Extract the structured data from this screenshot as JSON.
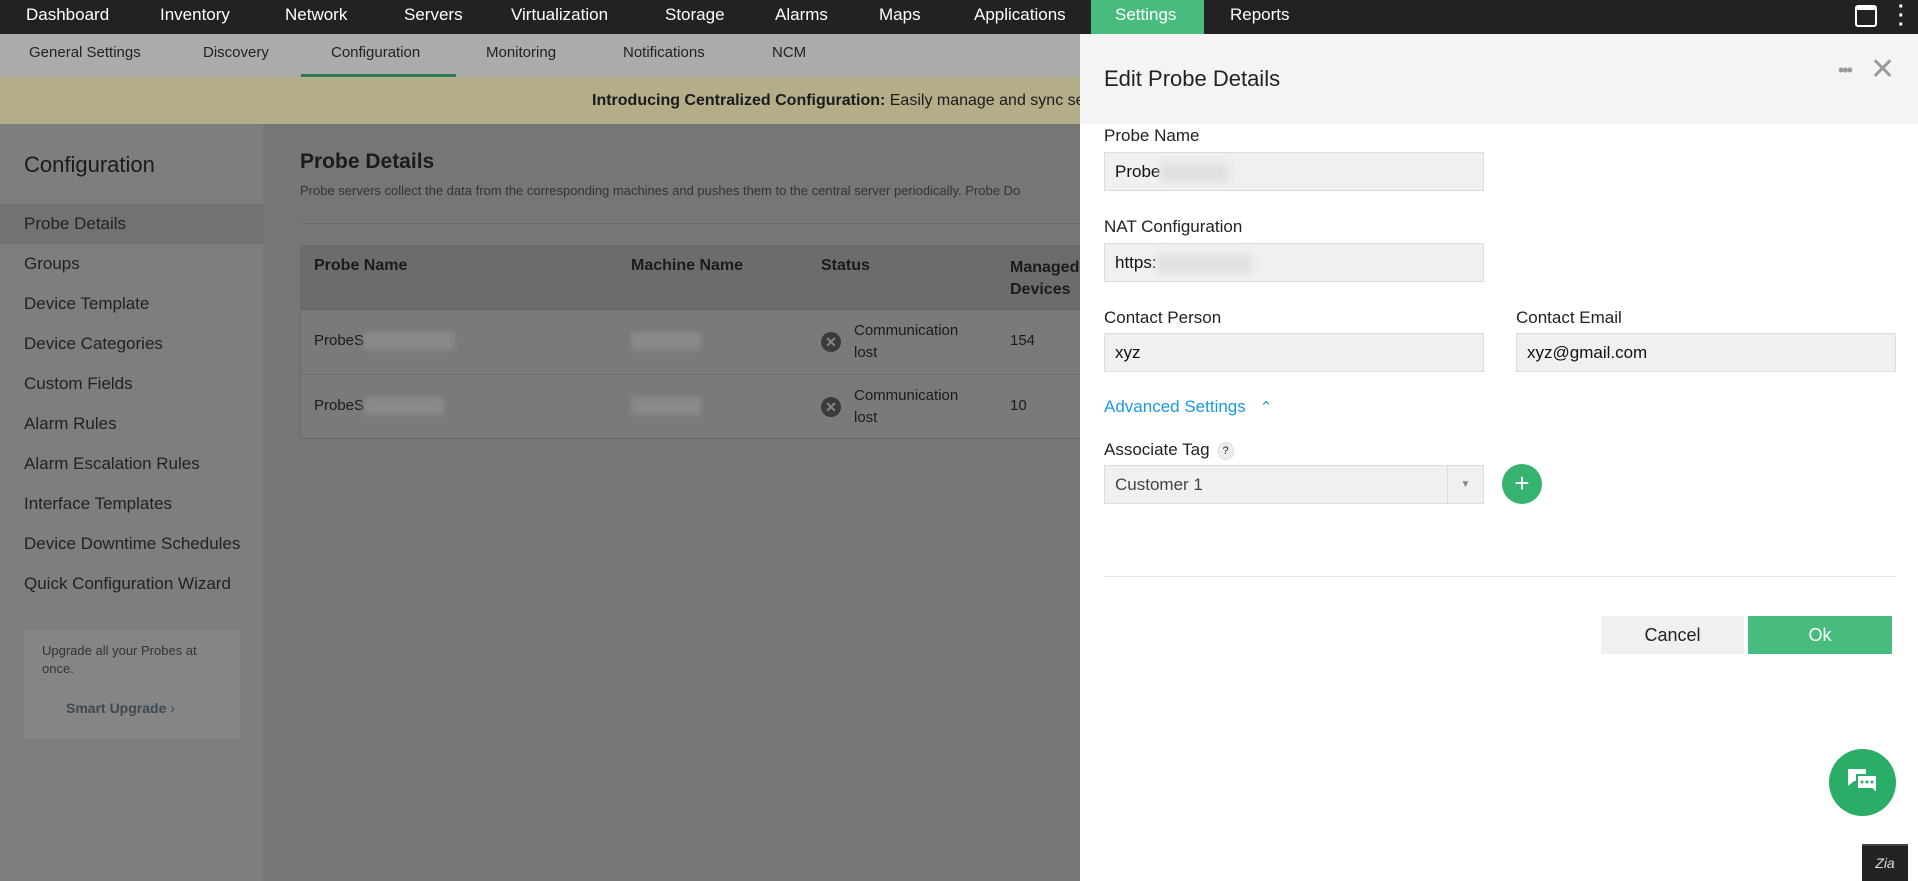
{
  "topnav": {
    "items": [
      "Dashboard",
      "Inventory",
      "Network",
      "Servers",
      "Virtualization",
      "Storage",
      "Alarms",
      "Maps",
      "Applications",
      "Settings",
      "Reports"
    ],
    "active": "Settings"
  },
  "subnav": {
    "items": [
      "General Settings",
      "Discovery",
      "Configuration",
      "Monitoring",
      "Notifications",
      "NCM"
    ],
    "active": "Configuration"
  },
  "banner": {
    "bold": "Introducing Centralized Configuration:",
    "text": " Easily manage and sync set"
  },
  "sidebar": {
    "title": "Configuration",
    "items": [
      "Probe Details",
      "Groups",
      "Device Template",
      "Device Categories",
      "Custom Fields",
      "Alarm Rules",
      "Alarm Escalation Rules",
      "Interface Templates",
      "Device Downtime Schedules",
      "Quick Configuration Wizard"
    ],
    "upgrade_text": "Upgrade all your Probes at once.",
    "upgrade_link": "Smart Upgrade"
  },
  "main": {
    "title": "Probe Details",
    "description": "Probe servers collect the data from the corresponding machines and pushes them to the central server periodically. Probe Do",
    "columns": [
      "Probe Name",
      "Machine Name",
      "Status",
      "Managed Devices"
    ],
    "rows": [
      {
        "probe": "ProbeS",
        "status": "Communication lost",
        "devices": "154"
      },
      {
        "probe": "ProbeS",
        "status": "Communication lost",
        "devices": "10"
      }
    ]
  },
  "panel": {
    "title": "Edit Probe Details",
    "probe_name_label": "Probe Name",
    "probe_name_value": "Probe",
    "nat_label": "NAT Configuration",
    "nat_value": "https:",
    "contact_person_label": "Contact Person",
    "contact_person_value": "xyz",
    "contact_email_label": "Contact Email",
    "contact_email_value": "xyz@gmail.com",
    "advanced_label": "Advanced Settings",
    "associate_tag_label": "Associate Tag",
    "help": "?",
    "tag_value": "Customer 1",
    "cancel": "Cancel",
    "ok": "Ok"
  },
  "colors": {
    "accent": "#48bc7e",
    "link": "#1a9ae0"
  }
}
